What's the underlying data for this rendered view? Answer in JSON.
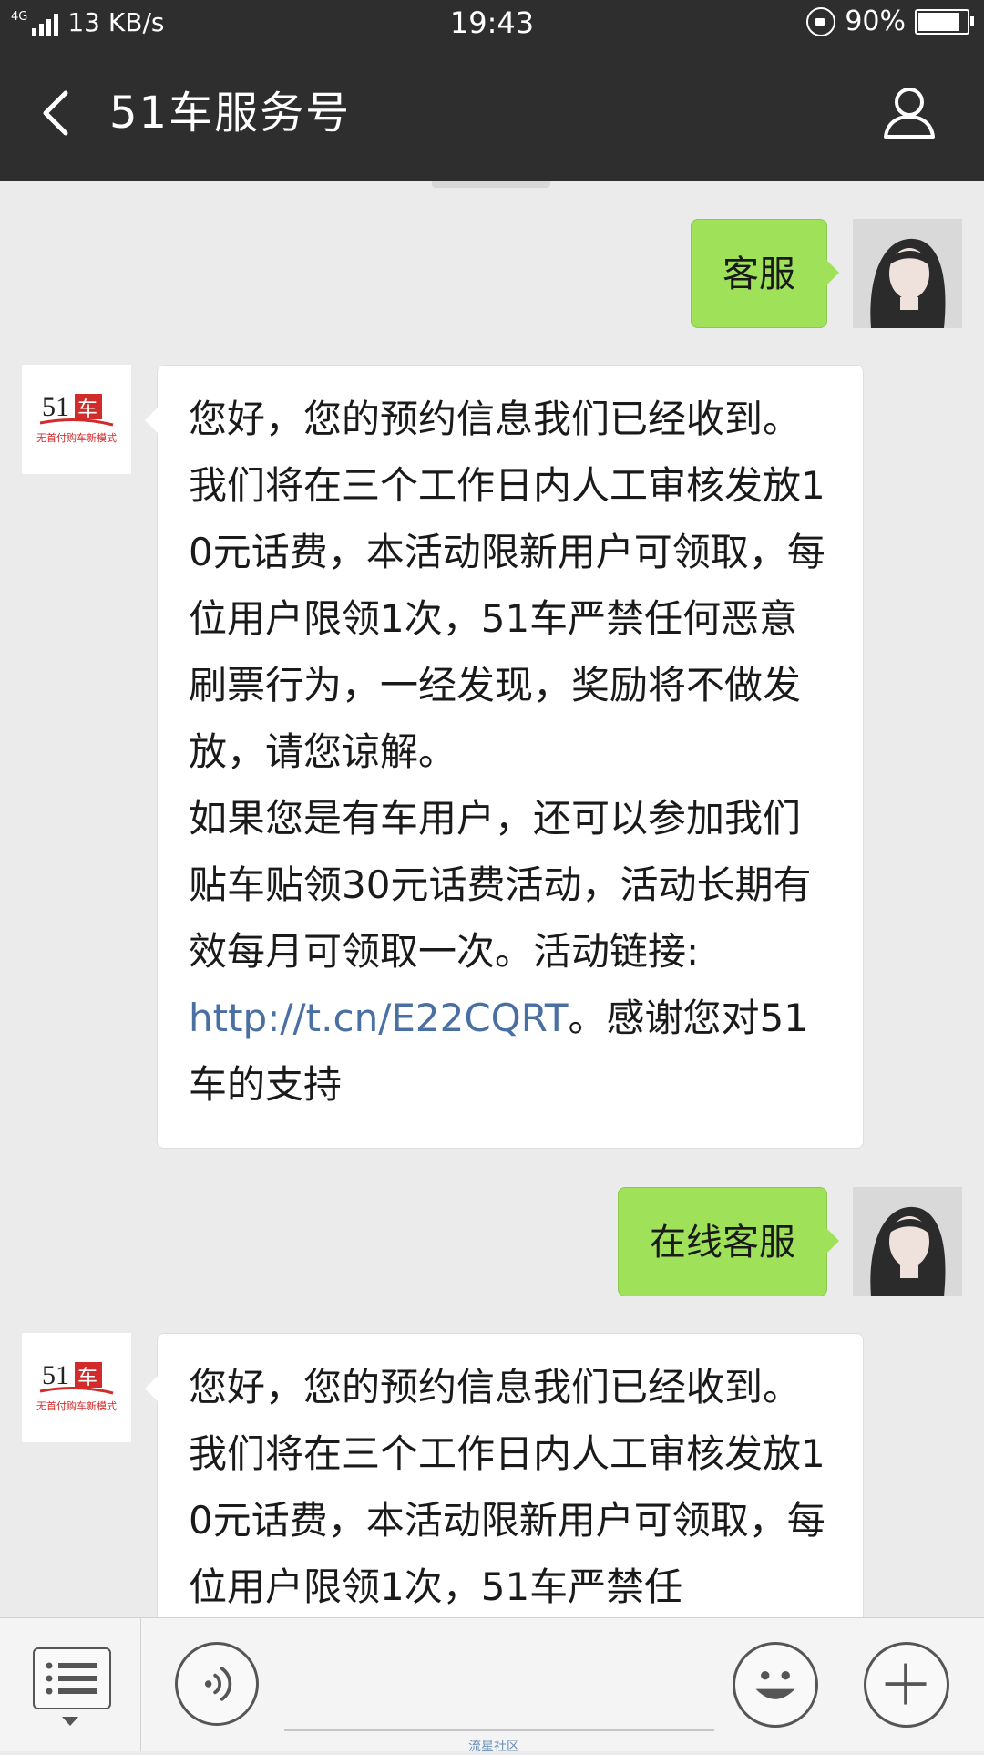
{
  "status_bar": {
    "network": "4G",
    "speed": "13 KB/s",
    "time": "19:43",
    "battery": "90%",
    "battery_level": 0.9
  },
  "header": {
    "title": "51车服务号",
    "back_icon": "chevron-left-icon",
    "profile_icon": "person-icon"
  },
  "messages": [
    {
      "from": "me",
      "text": "客服"
    },
    {
      "from": "service",
      "paragraphs": [
        "您好，您的预约信息我们已经收到。我们将在三个工作日内人工审核发放10元话费，本活动限新用户可领取，每位用户限领1次，51车严禁任何恶意刷票行为，一经发现，奖励将不做发放，请您谅解。",
        "如果您是有车用户，还可以参加我们贴车贴领30元话费活动，活动长期有效每月可领取一次。活动链接:"
      ],
      "link": "http://t.cn/E22CQRT",
      "after_link": "。感谢您对51车的支持"
    },
    {
      "from": "me",
      "text": "在线客服"
    },
    {
      "from": "service",
      "paragraphs": [
        "您好，您的预约信息我们已经收到。我们将在三个工作日内人工审核发放10元话费，本活动限新用户可领取，每位用户限领1次，51车严禁任"
      ]
    }
  ],
  "service_avatar": {
    "brand": "51车",
    "slogan": "无首付购车新模式"
  },
  "input_bar": {
    "placeholder": "",
    "watermark": "流星社区"
  },
  "colors": {
    "header_bg": "#2e2e2e",
    "chat_bg": "#ebebeb",
    "outgoing_bubble": "#9fe158",
    "incoming_bubble": "#ffffff",
    "link": "#4a6fa3"
  }
}
